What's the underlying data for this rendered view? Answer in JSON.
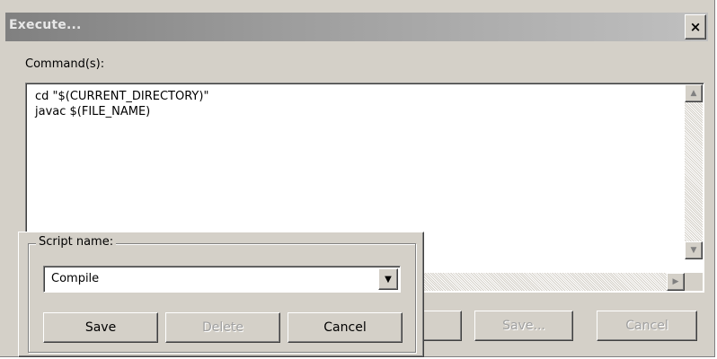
{
  "window": {
    "title": "Execute...",
    "close_glyph": "×"
  },
  "commands": {
    "label": "Command(s):",
    "text": "cd \"$(CURRENT_DIRECTORY)\"\njavac $(FILE_NAME)"
  },
  "scrollbar_icons": {
    "up": "▲",
    "down": "▼",
    "right": "▶"
  },
  "script_popup": {
    "group_label": "Script name:",
    "selected_script": "Compile",
    "dropdown_icon": "▼",
    "buttons": {
      "save": "Save",
      "delete": "Delete",
      "cancel": "Cancel"
    }
  },
  "dialog_buttons": {
    "save": "Save...",
    "cancel": "Cancel"
  },
  "colors": {
    "dialog_bg": "#d4d0c8",
    "titlebar_start": "#808080",
    "titlebar_end": "#c0c0c0",
    "disabled_text": "#a0a0a0"
  }
}
